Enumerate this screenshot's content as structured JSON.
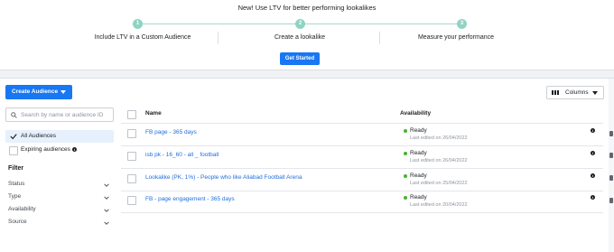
{
  "banner": {
    "title": "New! Use LTV for better performing lookalikes",
    "steps": [
      {
        "number": "1",
        "label": "Include LTV in a Custom Audience"
      },
      {
        "number": "2",
        "label": "Create a lookalike"
      },
      {
        "number": "3",
        "label": "Measure your performance"
      }
    ],
    "cta_label": "Get Started"
  },
  "toolbar": {
    "create_label": "Create Audience",
    "columns_label": "Columns"
  },
  "sidebar": {
    "search_placeholder": "Search by name or audience ID",
    "audience_filters": [
      {
        "label": "All Audiences",
        "selected": true
      },
      {
        "label": "Expiring audiences",
        "selected": false
      }
    ],
    "filter_title": "Filter",
    "filters": [
      "Status",
      "Type",
      "Availability",
      "Source"
    ]
  },
  "table": {
    "headers": {
      "name": "Name",
      "availability": "Availability"
    },
    "rows": [
      {
        "name": "FB page - 365 days",
        "status": "Ready",
        "edited": "Last edited on 26/04/2022"
      },
      {
        "name": "isb pk - 16_60 - all _ football",
        "status": "Ready",
        "edited": "Last edited on 26/04/2022"
      },
      {
        "name": "Lookalike (PK, 1%) - People who like Aliabad Football Arena",
        "status": "Ready",
        "edited": "Last edited on 25/04/2022"
      },
      {
        "name": "FB - page engagement - 365 days",
        "status": "Ready",
        "edited": "Last edited on 20/04/2022"
      }
    ]
  },
  "colors": {
    "accent": "#1877f2",
    "link": "#216fdb",
    "ready": "#42b72a",
    "step": "#8fd3c3"
  },
  "icons": [
    "search-icon",
    "checkmark-icon",
    "info-icon",
    "chevron-down-icon",
    "columns-icon",
    "caret-down-icon"
  ]
}
